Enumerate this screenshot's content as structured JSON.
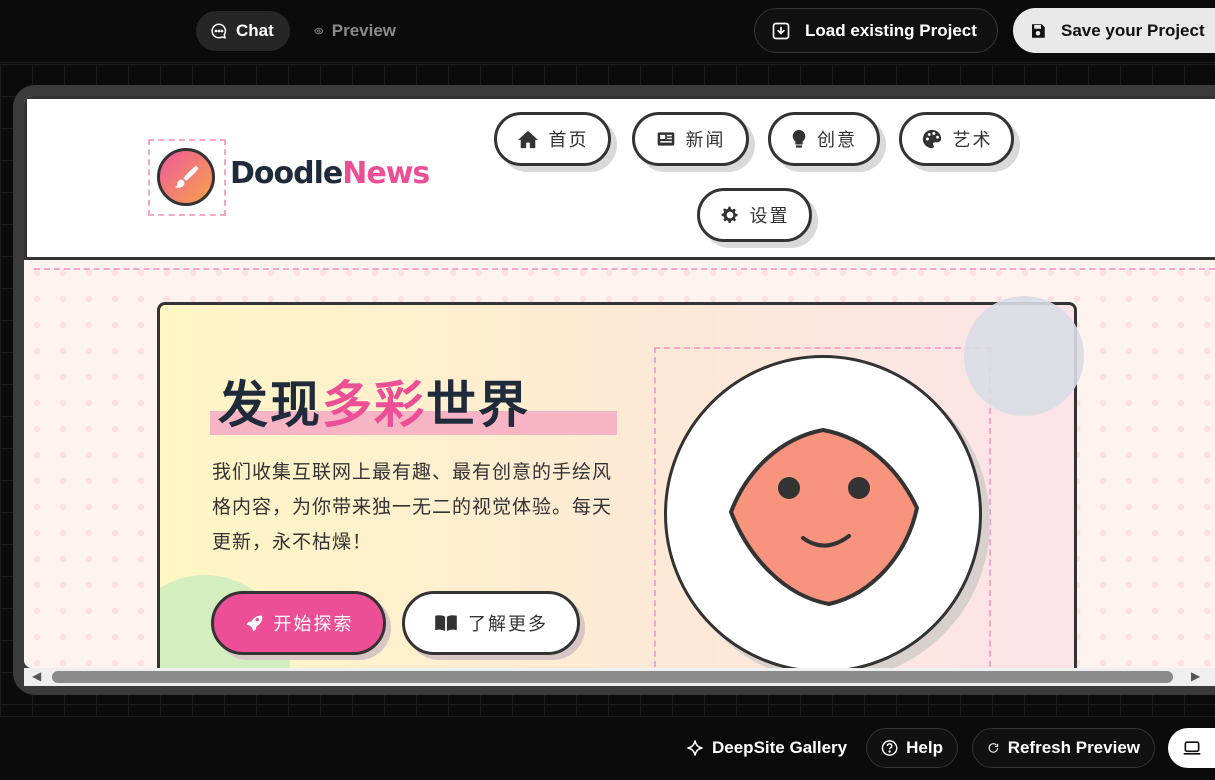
{
  "topbar": {
    "tabs": [
      {
        "label": "Chat",
        "icon": "chat-icon",
        "active": true
      },
      {
        "label": "Preview",
        "icon": "eye-icon",
        "active": false
      }
    ],
    "load_label": "Load existing Project",
    "save_label": "Save your Project"
  },
  "site": {
    "logo_part1": "Doodle",
    "logo_part2": "News",
    "nav": [
      {
        "label": "首页",
        "icon": "home-icon"
      },
      {
        "label": "新闻",
        "icon": "newspaper-icon"
      },
      {
        "label": "创意",
        "icon": "lightbulb-icon"
      },
      {
        "label": "艺术",
        "icon": "palette-icon"
      },
      {
        "label": "设置",
        "icon": "gear-icon"
      }
    ],
    "hero": {
      "title_part1": "发现",
      "title_highlight": "多彩",
      "title_part2": "世界",
      "description": "我们收集互联网上最有趣、最有创意的手绘风格内容，为你带来独一无二的视觉体验。每天更新，永不枯燥！",
      "primary_button": "开始探索",
      "secondary_button": "了解更多"
    }
  },
  "bottombar": {
    "gallery_label": "DeepSite Gallery",
    "help_label": "Help",
    "refresh_label": "Refresh Preview"
  },
  "colors": {
    "accent_pink": "#ec4f96",
    "dark": "#1f2a3a",
    "background": "#0b0b0b"
  }
}
